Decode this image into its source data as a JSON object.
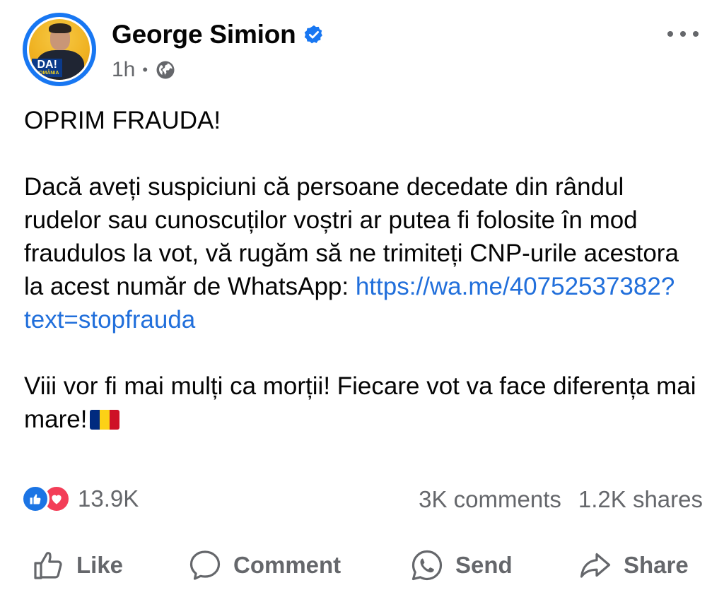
{
  "author": {
    "name": "George Simion",
    "time": "1h",
    "avatar_badge_line1": "DA!",
    "avatar_badge_line2": "ROMÂNIA"
  },
  "icons": {
    "verified": "verified-badge-icon",
    "audience": "globe-icon",
    "more": "more-options-icon",
    "like": "like-icon",
    "comment": "comment-icon",
    "send": "whatsapp-send-icon",
    "share": "share-icon"
  },
  "colors": {
    "link": "#216fdb",
    "verified": "#1877f2",
    "secondary_text": "#65676b",
    "like_reaction": "#1b74e4",
    "love_reaction": "#f33e58"
  },
  "post": {
    "line1": "OPRIM FRAUDA!",
    "paragraph2_text": "Dacă aveți suspiciuni că persoane decedate din rândul rudelor sau cunoscuților voștri ar putea fi folosite în mod fraudulos la vot, vă rugăm să ne trimiteți CNP-urile acestora la acest număr de WhatsApp:  ",
    "link_text_part1": "https://wa.me/40752537382?",
    "link_text_part2": "text=stopfrauda",
    "paragraph3_text": "Viii vor fi mai mulți ca morții! Fiecare vot va face diferența mai mare!"
  },
  "stats": {
    "reactions_count": "13.9K",
    "comments": "3K comments",
    "shares": "1.2K shares"
  },
  "actions": {
    "like": "Like",
    "comment": "Comment",
    "send": "Send",
    "share": "Share"
  }
}
